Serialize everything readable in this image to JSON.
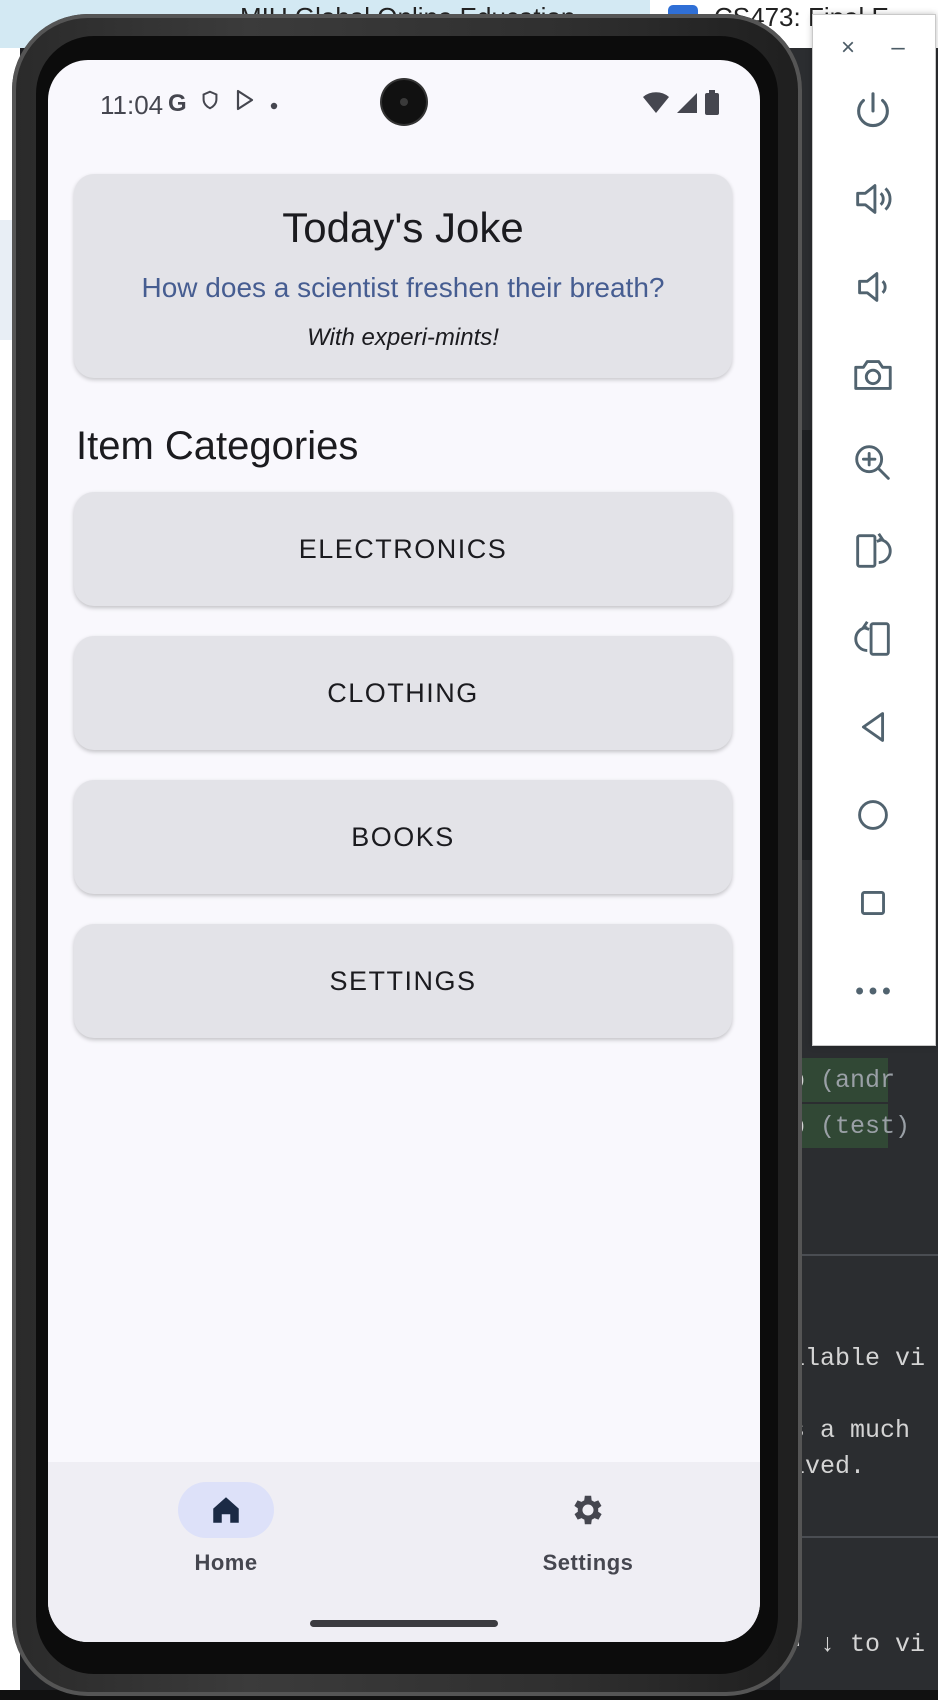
{
  "browser": {
    "tab_left_text": "MIU Global Online Education",
    "tab_right_text": "CS473: Final E"
  },
  "ide": {
    "line1_main": "p",
    "line1_dim": "(andr",
    "line2_main": "p",
    "line2_dim": "(test)",
    "line3": "ilable vi",
    "line4": "s a much",
    "line5": "lved.",
    "line6": "· ↓ to vi"
  },
  "emulator_toolbar": {
    "close_glyph": "×",
    "minimize_glyph": "–",
    "buttons": [
      "power-icon",
      "volume-up-icon",
      "volume-down-icon",
      "camera-icon",
      "zoom-icon",
      "rotate-left-icon",
      "rotate-right-icon",
      "back-icon",
      "home-icon",
      "overview-icon",
      "more-icon"
    ]
  },
  "status_bar": {
    "time": "11:04",
    "left_icons": [
      "google-icon",
      "shield-icon",
      "play-store-icon",
      "dot-icon"
    ],
    "right_icons": [
      "wifi-icon",
      "signal-icon",
      "battery-icon"
    ]
  },
  "joke": {
    "title": "Today's Joke",
    "question": "How does a scientist freshen their breath?",
    "answer": "With experi-mints!"
  },
  "categories": {
    "title": "Item Categories",
    "items": [
      "ELECTRONICS",
      "CLOTHING",
      "BOOKS",
      "SETTINGS"
    ]
  },
  "bottom_nav": {
    "items": [
      {
        "label": "Home",
        "icon": "home-icon",
        "selected": true
      },
      {
        "label": "Settings",
        "icon": "gear-icon",
        "selected": false
      }
    ]
  },
  "colors": {
    "screen_bg": "#f9f8fd",
    "card_bg": "#e3e3e8",
    "accent_text": "#465d91",
    "nav_active_pill": "#dde1f9"
  }
}
